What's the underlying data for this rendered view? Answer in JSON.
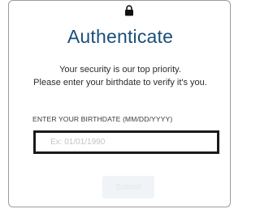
{
  "icons": {
    "lock": "lock-icon"
  },
  "colors": {
    "title": "#1a4f7a",
    "card_border": "#9c9c9c",
    "input_border": "#1a1a1a",
    "submit_bg": "#f0f4f7",
    "submit_text": "#e3e6ea"
  },
  "auth": {
    "title": "Authenticate",
    "subtitle_line1": "Your security is our top priority.",
    "subtitle_line2": "Please enter your birthdate to verify it's you.",
    "field_label": "ENTER YOUR BIRTHDATE (MM/DD/YYYY)",
    "field_placeholder": "Ex: 01/01/1990",
    "field_value": "",
    "submit_label": "Submit"
  }
}
